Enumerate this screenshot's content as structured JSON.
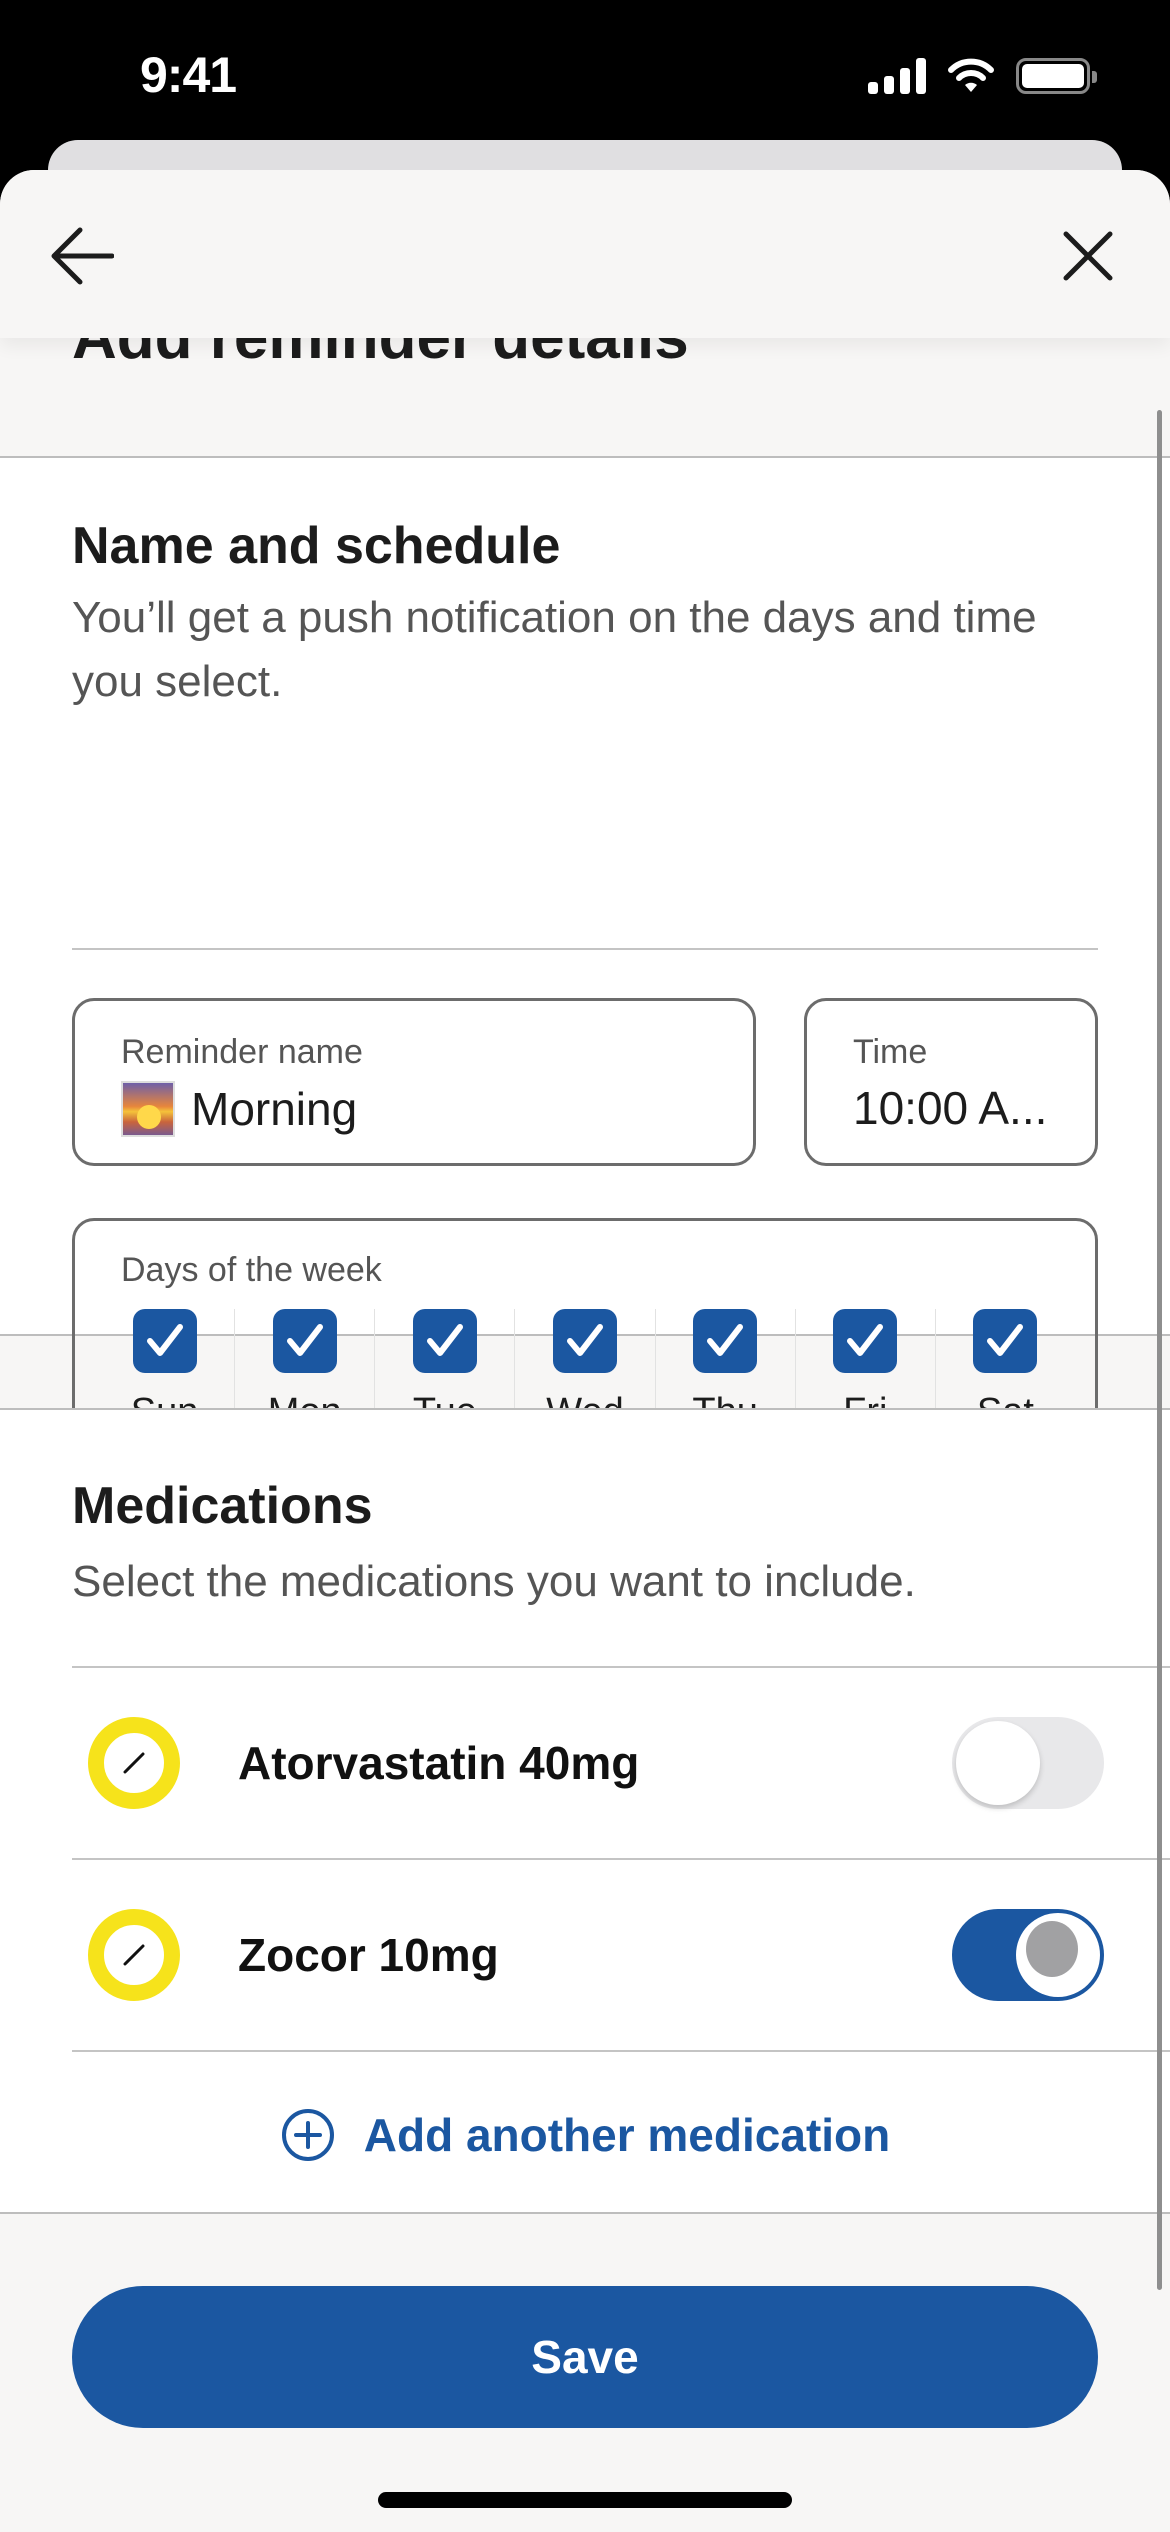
{
  "status_bar": {
    "time": "9:41"
  },
  "header": {
    "back_icon": "arrow-left-icon",
    "close_icon": "close-icon"
  },
  "page": {
    "title": "Add reminder details"
  },
  "schedule": {
    "title": "Name and schedule",
    "description": "You’ll get a push notification on the days and time you select.",
    "reminder_name": {
      "label": "Reminder name",
      "emoji": "sunrise-icon",
      "value": "Morning"
    },
    "time": {
      "label": "Time",
      "value": "10:00 A..."
    },
    "days": {
      "label": "Days of the week",
      "items": [
        {
          "label": "Sun",
          "checked": true
        },
        {
          "label": "Mon",
          "checked": true
        },
        {
          "label": "Tue",
          "checked": true
        },
        {
          "label": "Wed",
          "checked": true
        },
        {
          "label": "Thu",
          "checked": true
        },
        {
          "label": "Fri",
          "checked": true
        },
        {
          "label": "Sat",
          "checked": true
        }
      ]
    }
  },
  "medications": {
    "title": "Medications",
    "description": "Select the medications you want to include.",
    "items": [
      {
        "name": "Atorvastatin 40mg",
        "enabled": false
      },
      {
        "name": "Zocor 10mg",
        "enabled": true
      }
    ],
    "add_label": "Add another medication"
  },
  "footer": {
    "save_label": "Save"
  },
  "colors": {
    "accent": "#1b57a1",
    "pill": "#f6e31b",
    "background": "#f7f6f5"
  }
}
